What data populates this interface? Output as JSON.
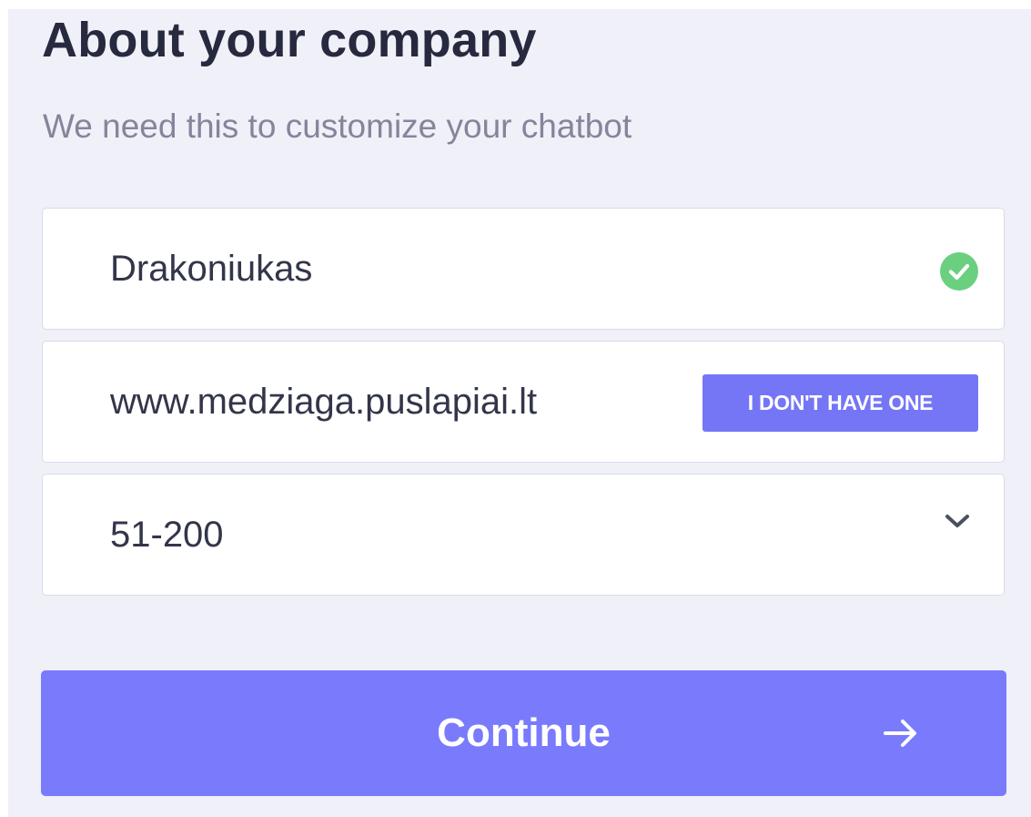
{
  "header": {
    "title": "About your company",
    "subtitle": "We need this to customize your chatbot"
  },
  "form": {
    "company_name": {
      "value": "Drakoniukas",
      "status_icon": "check-circle-icon",
      "status_color": "#6bcf80"
    },
    "website": {
      "value": "www.medziaga.puslapiai.lt",
      "no_website_label": "I DON'T HAVE ONE"
    },
    "company_size": {
      "selected": "51-200",
      "icon": "chevron-down-icon"
    }
  },
  "actions": {
    "continue_label": "Continue",
    "continue_icon": "arrow-right-icon"
  },
  "colors": {
    "accent": "#797bfc",
    "background": "#f0f0f9",
    "success": "#6bcf80"
  }
}
